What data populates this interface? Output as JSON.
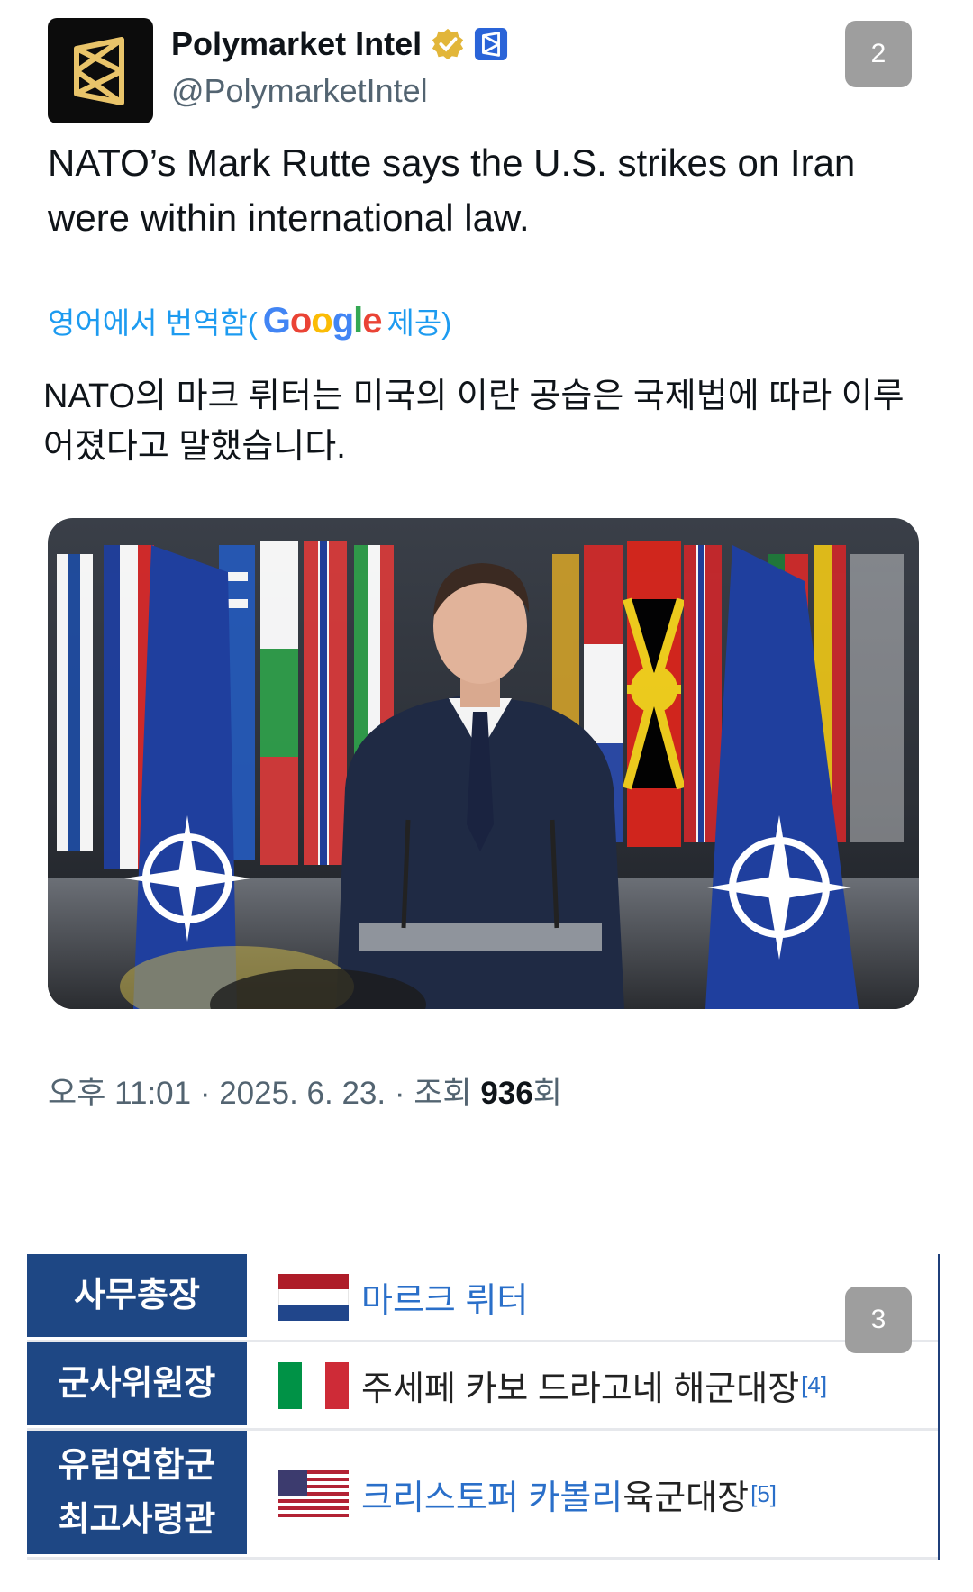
{
  "tweet": {
    "display_name": "Polymarket Intel",
    "handle": "@PolymarketIntel",
    "text": "NATO’s Mark Rutte says the U.S. strikes on Iran were within international law.",
    "translate_prefix": "영어에서 번역함(",
    "translate_brand": "Google",
    "translate_suffix": " 제공)",
    "translated_text": "NATO의 마크 뤼터는 미국의 이란 공습은 국제법에 따라 이루어졌다고 말했습니다.",
    "time": "오후 11:01 · 2025. 6. 23. · 조회 ",
    "views": "936",
    "views_suffix": "회"
  },
  "page_badges": {
    "first": "2",
    "second": "3"
  },
  "info_table": {
    "rows": [
      {
        "key": "사무총장",
        "value": "마르크 뤼터",
        "value_rest": "",
        "ref": "",
        "flag": "netherlands"
      },
      {
        "key": "군사위원장",
        "value": "",
        "value_rest": "주세페 카보 드라고네 해군대장",
        "ref": "[4]",
        "flag": "italy"
      },
      {
        "key": "유럽연합군\n최고사령관",
        "value": "크리스토퍼 카볼리",
        "value_rest": " 육군대장",
        "ref": "[5]",
        "flag": "usa"
      }
    ]
  },
  "colors": {
    "link": "#1d9bf0",
    "table_header": "#1e4784"
  }
}
